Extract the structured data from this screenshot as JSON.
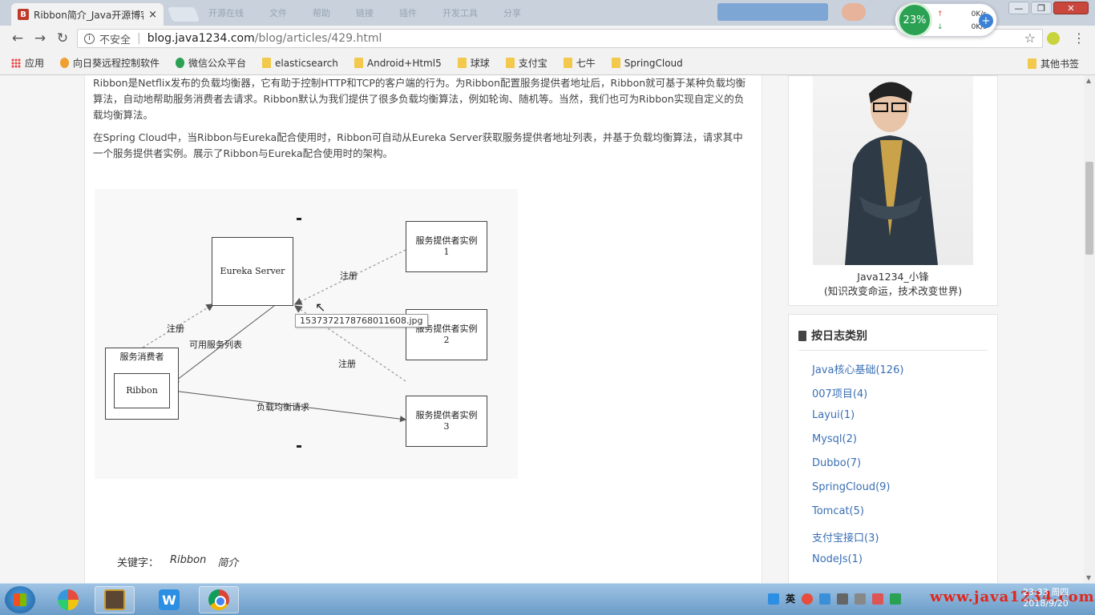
{
  "browser": {
    "tab": {
      "favicon_letter": "B",
      "title": "Ribbon简介_Java开源博客",
      "close": "×"
    },
    "blurred_tabs": [
      "开源在线",
      "文件",
      "帮助",
      "链接",
      "插件",
      "开发工具",
      "分享"
    ],
    "network_widget": {
      "percent": "23%",
      "upload": "0K/s",
      "download": "0K/s",
      "add": "+"
    },
    "window_buttons": [
      "—",
      "❐",
      "✕"
    ],
    "toolbar": {
      "back": "←",
      "forward": "→",
      "reload": "↻",
      "security_label": "不安全",
      "url_host": "blog.java1234.com",
      "url_path": "/blog/articles/429.html",
      "star": "☆",
      "menu": "⋮"
    },
    "bookmarks": {
      "items": [
        "应用",
        "向日葵远程控制软件",
        "微信公众平台",
        "elasticsearch",
        "Android+Html5",
        "球球",
        "支付宝",
        "七牛",
        "SpringCloud"
      ],
      "other": "其他书签"
    }
  },
  "article": {
    "p1": "Ribbon是Netflix发布的负载均衡器，它有助于控制HTTP和TCP的客户端的行为。为Ribbon配置服务提供者地址后，Ribbon就可基于某种负载均衡算法，自动地帮助服务消费者去请求。Ribbon默认为我们提供了很多负载均衡算法，例如轮询、随机等。当然，我们也可为Ribbon实现自定义的负载均衡算法。",
    "p2": "在Spring Cloud中，当Ribbon与Eureka配合使用时，Ribbon可自动从Eureka Server获取服务提供者地址列表，并基于负载均衡算法，请求其中一个服务提供者实例。展示了Ribbon与Eureka配合使用时的架构。",
    "diagram": {
      "eureka": "Eureka Server",
      "provider1": "服务提供者实例\n1",
      "provider2": "服务提供者实例\n2",
      "provider3": "服务提供者实例\n3",
      "consumer": "服务消费者",
      "ribbon": "Ribbon",
      "register_top": "注册",
      "register_left": "注册",
      "register_bottom": "注册",
      "service_list": "可用服务列表",
      "lb_request": "负载均衡请求"
    },
    "tooltip": "1537372178768011608.jpg",
    "keywords_label": "关键字：",
    "keywords": [
      "Ribbon",
      "简介"
    ]
  },
  "sidebar": {
    "profile": {
      "name": "Java1234_小锋",
      "motto": "(知识改变命运，技术改变世界)"
    },
    "categories_title": "按日志类别",
    "categories": [
      "Java核心基础(126)",
      "007项目(4)",
      "Layui(1)",
      "Mysql(2)",
      "Dubbo(7)",
      "SpringCloud(9)",
      "Tomcat(5)",
      "支付宝接口(3)",
      "NodeJs(1)"
    ]
  },
  "taskbar": {
    "tray_lang": "英",
    "time": "23:33 周四",
    "date": "2018/9/20",
    "watermark": "www.java1234.com"
  },
  "colors": {
    "link": "#3a6fb4",
    "accent_red": "#c0392b",
    "network_green": "#2aa153"
  }
}
